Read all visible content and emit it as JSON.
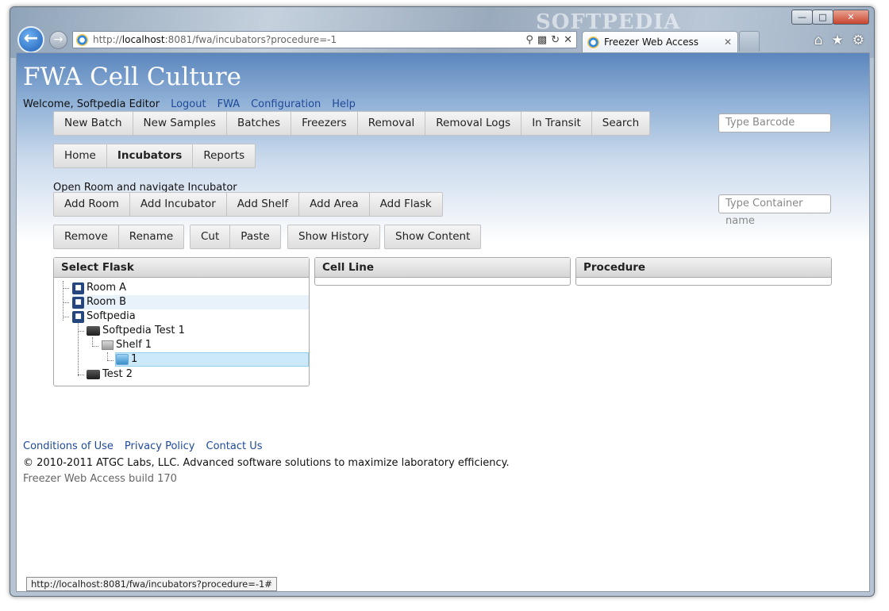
{
  "browser": {
    "address_host": "localhost",
    "address_prefix": "http://",
    "address_suffix": ":8081/fwa/incubators?procedure=-1",
    "tab_title": "Freezer Web Access",
    "tab_close": "✕",
    "watermark": "SOFTPEDIA"
  },
  "app": {
    "title": "FWA Cell Culture",
    "welcome": "Welcome, Softpedia Editor",
    "header_links": [
      "Logout",
      "FWA",
      "Configuration",
      "Help"
    ]
  },
  "main_menu": [
    "New Batch",
    "New Samples",
    "Batches",
    "Freezers",
    "Removal",
    "Removal Logs",
    "In Transit",
    "Search"
  ],
  "barcode_placeholder": "Type Barcode",
  "sub_menu": [
    "Home",
    "Incubators",
    "Reports"
  ],
  "nav_caption": "Open Room and navigate Incubator",
  "add_toolbar": [
    "Add Room",
    "Add Incubator",
    "Add Shelf",
    "Add Area",
    "Add Flask"
  ],
  "container_placeholder": "Type Container name",
  "edit_toolbar": {
    "group1": [
      "Remove",
      "Rename"
    ],
    "group2": [
      "Cut",
      "Paste"
    ],
    "show_history": "Show History",
    "show_content": "Show Content"
  },
  "panels": {
    "select_flask": "Select Flask",
    "cell_line": "Cell Line",
    "procedure": "Procedure"
  },
  "tree": [
    "Room A",
    "Room B",
    "Softpedia",
    "Softpedia Test 1",
    "Shelf 1",
    "1",
    "Test 2"
  ],
  "footer": {
    "links": [
      "Conditions of Use",
      "Privacy Policy",
      "Contact Us"
    ],
    "copyright": "© 2010-2011 ATGC Labs, LLC. Advanced software solutions to maximize laboratory efficiency.",
    "build": "Freezer Web Access build 170"
  },
  "status_url": "http://localhost:8081/fwa/incubators?procedure=-1#"
}
